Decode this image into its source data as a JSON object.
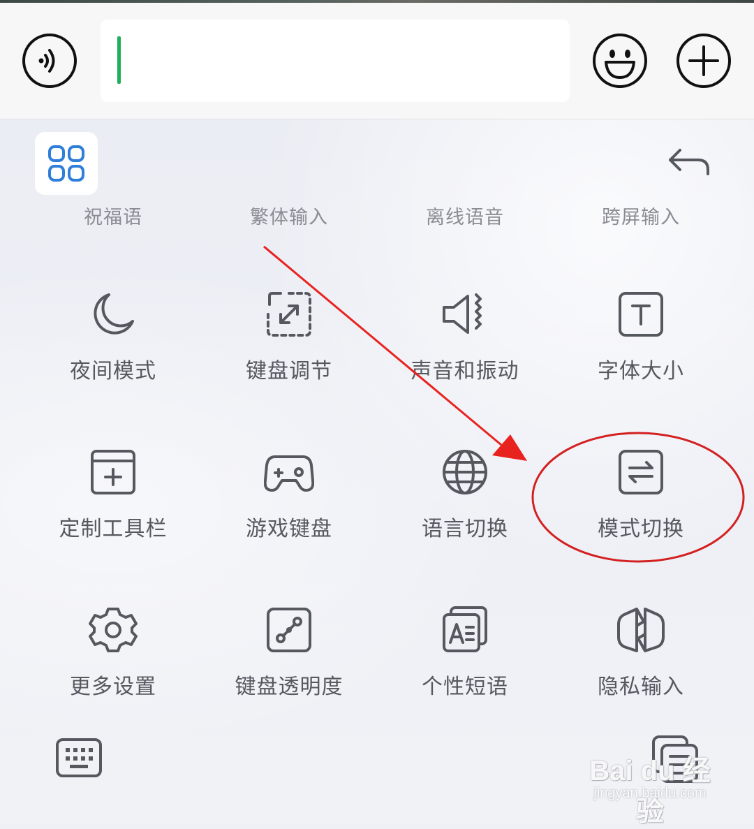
{
  "input_bar": {
    "voice_icon": "voice-wave-icon",
    "emoji_icon": "smiley-icon",
    "plus_icon": "plus-icon",
    "text_value": ""
  },
  "panel": {
    "apps_icon": "grid-four-icon",
    "back_icon": "undo-arrow-icon",
    "partial_row": [
      {
        "label": "祝福语"
      },
      {
        "label": "繁体输入"
      },
      {
        "label": "离线语音"
      },
      {
        "label": "跨屏输入"
      }
    ],
    "tools": [
      {
        "label": "夜间模式",
        "icon": "moon-icon"
      },
      {
        "label": "键盘调节",
        "icon": "resize-icon"
      },
      {
        "label": "声音和振动",
        "icon": "speaker-vibrate-icon"
      },
      {
        "label": "字体大小",
        "icon": "font-size-icon"
      },
      {
        "label": "定制工具栏",
        "icon": "add-toolbar-icon"
      },
      {
        "label": "游戏键盘",
        "icon": "gamepad-icon"
      },
      {
        "label": "语言切换",
        "icon": "globe-icon"
      },
      {
        "label": "模式切换",
        "icon": "switch-mode-icon"
      },
      {
        "label": "更多设置",
        "icon": "gear-icon"
      },
      {
        "label": "键盘透明度",
        "icon": "transparency-icon"
      },
      {
        "label": "个性短语",
        "icon": "phrases-icon"
      },
      {
        "label": "隐私输入",
        "icon": "privacy-icon"
      }
    ],
    "keyboard_icon": "keyboard-icon",
    "clipboard_icon": "clipboard-icon"
  },
  "annotation": {
    "arrow_color": "#e8231f",
    "circle_color": "#d32020"
  },
  "watermark": {
    "main": "Bai du 经验",
    "url": "jingyan.baidu.com"
  },
  "colors": {
    "accent_green": "#1fae5a",
    "apps_blue": "#2f7fd9",
    "icon_gray": "#55585f"
  }
}
